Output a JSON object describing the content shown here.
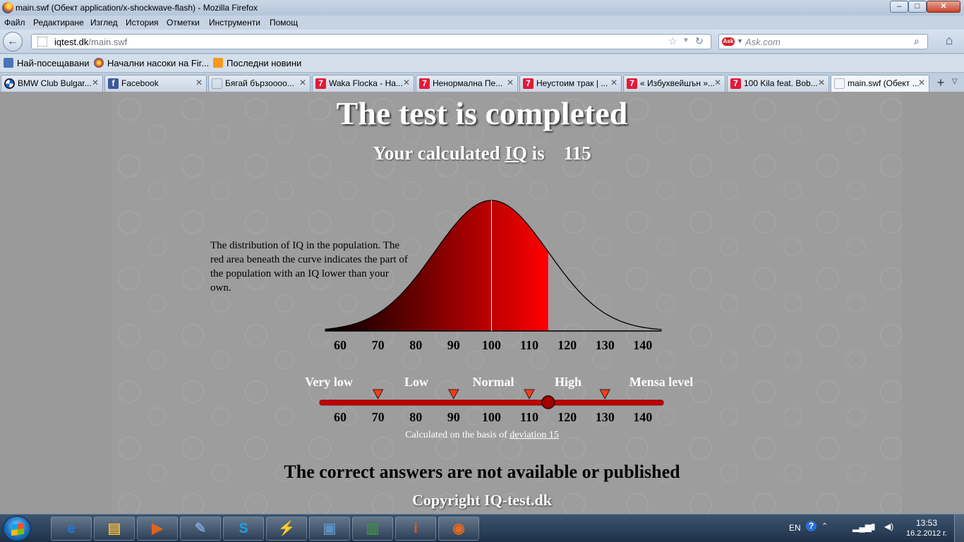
{
  "window": {
    "title": "main.swf (Обект application/x-shockwave-flash) - Mozilla Firefox",
    "min_label": "–",
    "max_label": "□",
    "close_label": "✕"
  },
  "menu": {
    "file": "Файл",
    "edit": "Редактиране",
    "view": "Изглед",
    "history": "История",
    "bookmarks": "Отметки",
    "tools": "Инструменти",
    "help": "Помощ"
  },
  "nav": {
    "url_host": "iqtest.dk",
    "url_path": "/main.swf",
    "search_placeholder": "Ask.com"
  },
  "bookmarks_bar": [
    {
      "label": "Най-посещавани",
      "icon": "most-visited-icon"
    },
    {
      "label": "Начални насоки на Fir...",
      "icon": "firefox-icon"
    },
    {
      "label": "Последни новини",
      "icon": "rss-icon"
    }
  ],
  "tabs": [
    {
      "label": "BMW Club Bulgar...",
      "icon": "bmw-icon"
    },
    {
      "label": "Facebook",
      "icon": "facebook-icon"
    },
    {
      "label": "Бягай бързоооо...",
      "icon": "blank-page-icon"
    },
    {
      "label": "Waka Flocka - На...",
      "icon": "seven-icon"
    },
    {
      "label": "Ненормална Пе...",
      "icon": "seven-icon"
    },
    {
      "label": "Неустоим трак | ...",
      "icon": "seven-icon"
    },
    {
      "label": "« Избухвейшън »...",
      "icon": "seven-icon"
    },
    {
      "label": "100 Kila feat. Bob...",
      "icon": "seven-icon"
    },
    {
      "label": "main.swf (Обект ...",
      "icon": "blank-page-icon",
      "active": true
    }
  ],
  "page": {
    "title": "The test is completed",
    "iq_prefix": "Your calculated ",
    "iq_word": "IQ",
    "iq_is": " is",
    "iq_value": "115",
    "description": "The distribution of IQ in the population. The red area beneath the curve indicates the part of the population with an IQ lower than your own.",
    "deviation_prefix": "Calculated on the basis of ",
    "deviation_link": "deviation 15",
    "no_answers": "The correct answers are not available or published",
    "copyright": "Copyright IQ-test.dk"
  },
  "chart_data": {
    "type": "area",
    "title": "",
    "xlabel": "",
    "ylabel": "",
    "distribution": "normal",
    "mean": 100,
    "sd": 15,
    "shaded_to": 115,
    "x_ticks": [
      60,
      70,
      80,
      90,
      100,
      110,
      120,
      130,
      140
    ],
    "xlim": [
      60,
      140
    ],
    "colors": {
      "shade_left": "#000000",
      "shade_right": "#ff0000",
      "curve": "#000000",
      "mean_line": "#ffffff"
    }
  },
  "scale": {
    "bands": [
      "Very low",
      "Low",
      "Normal",
      "High",
      "Mensa level"
    ],
    "ticks": [
      60,
      70,
      80,
      90,
      100,
      110,
      120,
      130,
      140
    ],
    "marker_values": [
      70,
      90,
      110,
      130
    ],
    "current_value": 115,
    "bar_color": "#c40000",
    "marker_color": "#ff3b1a"
  },
  "taskbar": {
    "apps": [
      {
        "name": "internet-explorer",
        "glyph": "e"
      },
      {
        "name": "explorer",
        "glyph": "▤"
      },
      {
        "name": "media-player",
        "glyph": "▶"
      },
      {
        "name": "paint",
        "glyph": "✎"
      },
      {
        "name": "skype",
        "glyph": "S"
      },
      {
        "name": "winamp",
        "glyph": "⚡"
      },
      {
        "name": "photo-viewer",
        "glyph": "▣"
      },
      {
        "name": "monitor",
        "glyph": "▥"
      },
      {
        "name": "info",
        "glyph": "i"
      },
      {
        "name": "firefox",
        "glyph": "◉"
      }
    ],
    "lang": "EN",
    "time": "13:53",
    "date": "16.2.2012 г."
  }
}
